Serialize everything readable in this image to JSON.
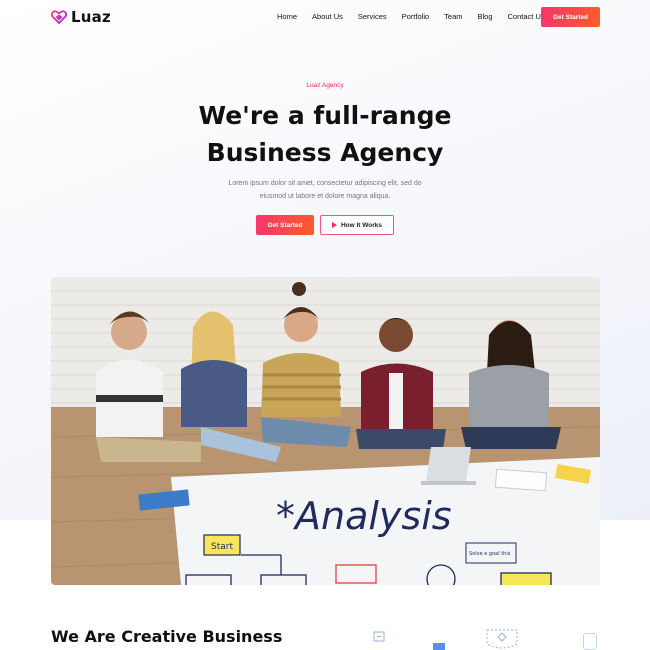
{
  "brand": {
    "name": "Luaz",
    "accent": "#f5366b",
    "accent_end": "#ff5a2c"
  },
  "nav": {
    "items": [
      "Home",
      "About Us",
      "Services",
      "Portfolio",
      "Team",
      "Blog",
      "Contact Us"
    ],
    "cta_label": "Get Started"
  },
  "hero": {
    "eyebrow": "Luaz Agency",
    "headline_line1": "We're a full-range",
    "headline_line2": "Business Agency",
    "subtext": "Lorem ipsum dolor sit amet, consectetur adipiscing elit, sed do eiusmod ut labore et dolore magna aliqua.",
    "primary_button": "Get Started",
    "secondary_button": "How It Works",
    "secondary_icon": "play-icon",
    "image_text": "*Analysis",
    "image_notes": [
      "Start",
      "Solve e goal this"
    ]
  },
  "section": {
    "title": "We Are Creative Business"
  }
}
